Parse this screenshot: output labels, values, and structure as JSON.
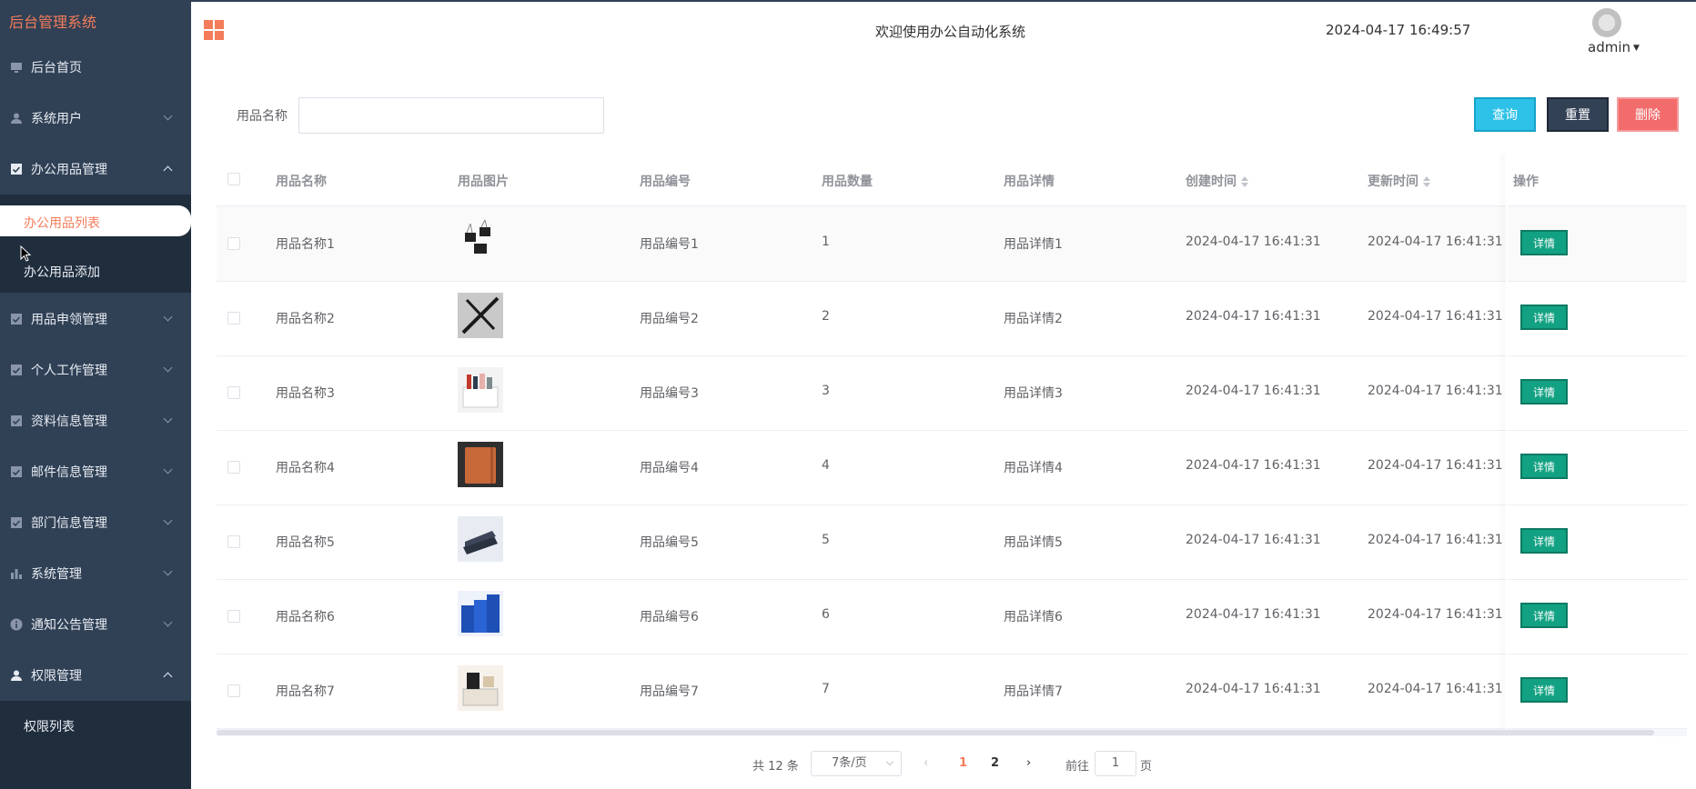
{
  "sidebar": {
    "brand": "后台管理系统",
    "items": [
      {
        "label": "后台首页",
        "icon": "monitor-icon"
      },
      {
        "label": "系统用户",
        "icon": "user-icon"
      },
      {
        "label": "办公用品管理",
        "icon": "checkbox-icon"
      },
      {
        "label": "用品申领管理",
        "icon": "checkbox-icon"
      },
      {
        "label": "个人工作管理",
        "icon": "checkbox-icon"
      },
      {
        "label": "资料信息管理",
        "icon": "checkbox-icon"
      },
      {
        "label": "邮件信息管理",
        "icon": "checkbox-icon"
      },
      {
        "label": "部门信息管理",
        "icon": "checkbox-icon"
      },
      {
        "label": "系统管理",
        "icon": "bar-chart-icon"
      },
      {
        "label": "通知公告管理",
        "icon": "info-icon"
      },
      {
        "label": "权限管理",
        "icon": "user-icon"
      }
    ],
    "sub_office": [
      "办公用品列表",
      "办公用品添加"
    ],
    "sub_perm": [
      "权限列表"
    ]
  },
  "header": {
    "welcome": "欢迎使用办公自动化系统",
    "datetime": "2024-04-17 16:49:57",
    "user": "admin"
  },
  "search": {
    "label": "用品名称",
    "value": "",
    "query_label": "查询",
    "reset_label": "重置",
    "delete_label": "删除"
  },
  "table": {
    "headers": [
      "用品名称",
      "用品图片",
      "用品编号",
      "用品数量",
      "用品详情",
      "创建时间",
      "更新时间",
      "操作"
    ],
    "rows": [
      {
        "name": "用品名称1",
        "code": "用品编号1",
        "qty": "1",
        "detail": "用品详情1",
        "created": "2024-04-17 16:41:31",
        "updated": "2024-04-17 16:41:31",
        "action": "详情"
      },
      {
        "name": "用品名称2",
        "code": "用品编号2",
        "qty": "2",
        "detail": "用品详情2",
        "created": "2024-04-17 16:41:31",
        "updated": "2024-04-17 16:41:31",
        "action": "详情"
      },
      {
        "name": "用品名称3",
        "code": "用品编号3",
        "qty": "3",
        "detail": "用品详情3",
        "created": "2024-04-17 16:41:31",
        "updated": "2024-04-17 16:41:31",
        "action": "详情"
      },
      {
        "name": "用品名称4",
        "code": "用品编号4",
        "qty": "4",
        "detail": "用品详情4",
        "created": "2024-04-17 16:41:31",
        "updated": "2024-04-17 16:41:31",
        "action": "详情"
      },
      {
        "name": "用品名称5",
        "code": "用品编号5",
        "qty": "5",
        "detail": "用品详情5",
        "created": "2024-04-17 16:41:31",
        "updated": "2024-04-17 16:41:31",
        "action": "详情"
      },
      {
        "name": "用品名称6",
        "code": "用品编号6",
        "qty": "6",
        "detail": "用品详情6",
        "created": "2024-04-17 16:41:31",
        "updated": "2024-04-17 16:41:31",
        "action": "详情"
      },
      {
        "name": "用品名称7",
        "code": "用品编号7",
        "qty": "7",
        "detail": "用品详情7",
        "created": "2024-04-17 16:41:31",
        "updated": "2024-04-17 16:41:31",
        "action": "详情"
      }
    ]
  },
  "pagination": {
    "total": "共 12 条",
    "page_size": "7条/页",
    "pages": [
      "1",
      "2"
    ],
    "current": "1",
    "goto_prefix": "前往",
    "goto_value": "1",
    "goto_suffix": "页"
  },
  "colors": {
    "sidebar_bg": "#304156",
    "accent": "#f47c5a",
    "query": "#2ec2e8",
    "reset": "#334155",
    "delete": "#f26c6c",
    "detail": "#12a182"
  }
}
